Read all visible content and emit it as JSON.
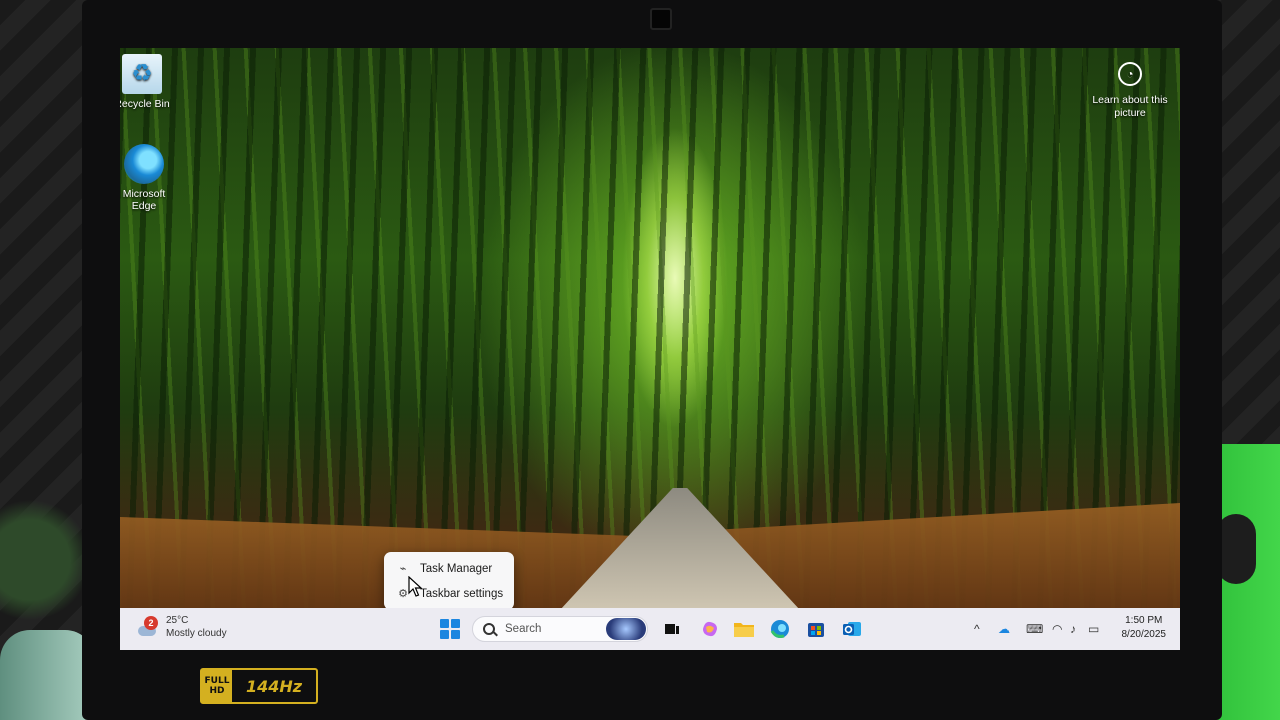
{
  "desktop": {
    "icons": [
      {
        "label": "Recycle Bin",
        "icon": "recycle-bin-icon"
      },
      {
        "label": "Microsoft Edge",
        "icon": "edge-icon"
      }
    ],
    "learn_about": "Learn about this picture"
  },
  "context_menu": {
    "items": [
      {
        "label": "Task Manager",
        "icon": "task-manager-icon"
      },
      {
        "label": "Taskbar settings",
        "icon": "gear-icon"
      }
    ]
  },
  "taskbar": {
    "weather": {
      "temperature": "25°C",
      "condition": "Mostly cloudy",
      "badge": "2"
    },
    "search_label": "Search",
    "pinned": [
      "start-icon",
      "task-view-icon",
      "copilot-icon",
      "file-explorer-icon",
      "edge-icon",
      "microsoft-store-icon",
      "outlook-icon"
    ],
    "tray": {
      "time": "1:50 PM",
      "date": "8/20/2025"
    }
  },
  "hardware": {
    "badge_top": "FULL",
    "badge_bottom": "HD",
    "refresh_rate": "144Hz"
  },
  "colors": {
    "accent": "#1b86e0",
    "taskbar_bg": "#ecebf2"
  }
}
